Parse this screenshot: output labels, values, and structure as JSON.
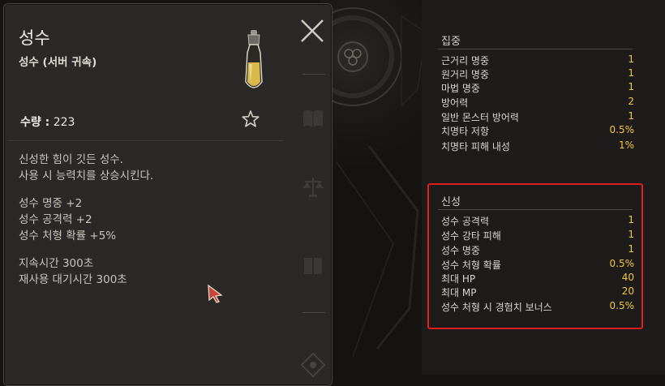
{
  "item": {
    "name": "성수",
    "type": "성수 (서버 귀속)",
    "quantity_label": "수량 :",
    "quantity": "223",
    "description": [
      "신성한 힘이 깃든 성수.",
      "사용 시 능력치를 상승시킨다."
    ],
    "effects": [
      "성수 명중 +2",
      "성수 공격력 +2",
      "성수 처형 확률 +5%"
    ],
    "durations": [
      "지속시간 300초",
      "재사용 대기시간 300초"
    ]
  },
  "stats": {
    "focus": {
      "title": "집중",
      "rows": [
        {
          "name": "근거리 명중",
          "value": "1"
        },
        {
          "name": "원거리 명중",
          "value": "1"
        },
        {
          "name": "마법 명중",
          "value": "1"
        },
        {
          "name": "방어력",
          "value": "2"
        },
        {
          "name": "일반 몬스터 방어력",
          "value": "1"
        },
        {
          "name": "치명타 저항",
          "value": "0.5%"
        },
        {
          "name": "치명타 피해 내성",
          "value": "1%"
        }
      ]
    },
    "holy": {
      "title": "신성",
      "rows": [
        {
          "name": "성수 공격력",
          "value": "1"
        },
        {
          "name": "성수 강타 피해",
          "value": "1"
        },
        {
          "name": "성수 명중",
          "value": "1"
        },
        {
          "name": "성수 처형 확률",
          "value": "0.5%"
        },
        {
          "name": "최대 HP",
          "value": "40"
        },
        {
          "name": "최대 MP",
          "value": "20"
        },
        {
          "name": "성수 처형 시 경험치 보너스",
          "value": "0.5%"
        }
      ]
    }
  },
  "colors": {
    "value_gold": "#f2c63b",
    "highlight_red": "#e11d24",
    "panel_bg": "#2a2927"
  },
  "icons": [
    "close-icon",
    "star-icon",
    "potion-icon",
    "book-icon",
    "scales-icon",
    "cards-icon",
    "rune-icon",
    "cursor-icon"
  ]
}
